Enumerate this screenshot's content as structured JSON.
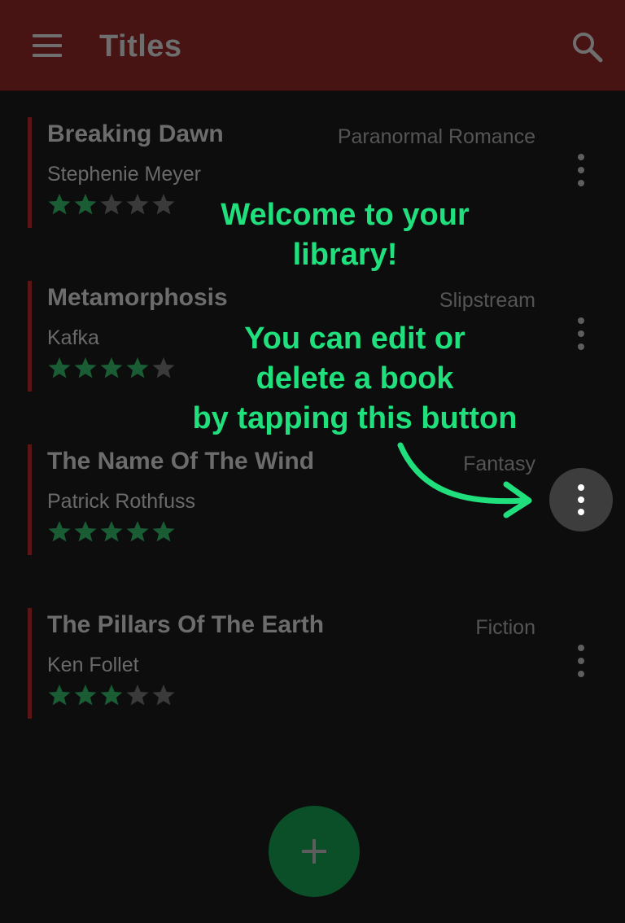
{
  "app_bar": {
    "title": "Titles",
    "menu_icon": "hamburger-menu-icon",
    "search_icon": "search-icon",
    "background": "#481313"
  },
  "books": [
    {
      "title": "Breaking Dawn",
      "author": "Stephenie Meyer",
      "genre": "Paranormal Romance",
      "rating": 2,
      "max_rating": 5
    },
    {
      "title": "Metamorphosis",
      "author": "Kafka",
      "genre": "Slipstream",
      "rating": 4,
      "max_rating": 5
    },
    {
      "title": "The Name Of The Wind",
      "author": "Patrick Rothfuss",
      "genre": "Fantasy",
      "rating": 5,
      "max_rating": 5
    },
    {
      "title": "The Pillars Of The Earth",
      "author": "Ken Follet",
      "genre": "Fiction",
      "rating": 3,
      "max_rating": 5
    }
  ],
  "coach": {
    "welcome_line1": "Welcome to your",
    "welcome_line2": "library!",
    "hint_line1": "You can edit or",
    "hint_line2": "delete a book",
    "hint_line3": "by tapping this button",
    "accent": "#1fe07d"
  },
  "fab": {
    "icon": "plus-icon",
    "color": "#0b4f28"
  },
  "colors": {
    "star_filled": "#1a5c34",
    "star_empty": "#3a3a3a",
    "item_accent": "#5a1515"
  }
}
